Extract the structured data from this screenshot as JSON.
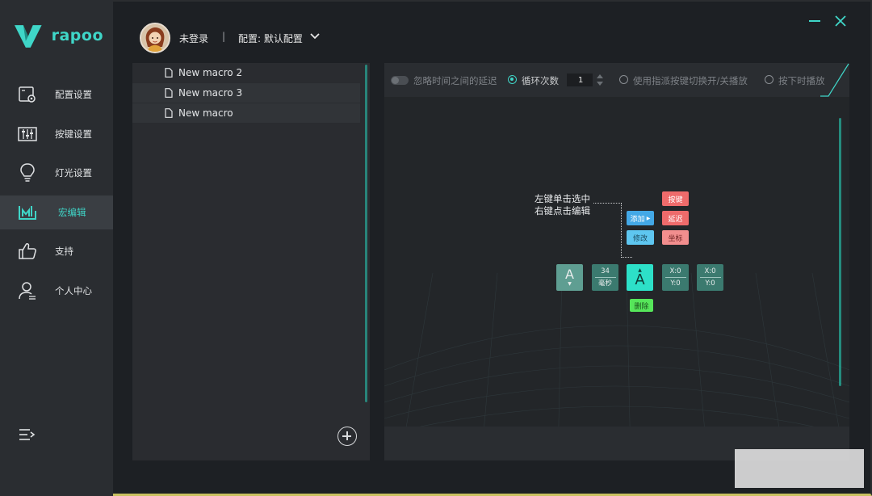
{
  "app": {
    "brand": "rapoo"
  },
  "sidebar": {
    "items": [
      {
        "label": "配置设置",
        "icon": "settings-card-icon"
      },
      {
        "label": "按键设置",
        "icon": "sliders-icon"
      },
      {
        "label": "灯光设置",
        "icon": "lightbulb-icon"
      },
      {
        "label": "宏编辑",
        "icon": "macro-icon"
      },
      {
        "label": "支持",
        "icon": "thumbs-up-icon"
      },
      {
        "label": "个人中心",
        "icon": "user-icon"
      }
    ],
    "active_index": 3
  },
  "header": {
    "user_status": "未登录",
    "separator": "|",
    "config_label": "配置: 默认配置"
  },
  "macros": {
    "items": [
      "New macro 2",
      "New macro 3",
      "New macro"
    ]
  },
  "toolbar": {
    "ignore_delay": "忽略时间之间的延迟",
    "loop_times": "循环次数",
    "loop_count": "1",
    "toggle_mode": "使用指派按键切换开/关播放",
    "hold_mode": "按下时播放"
  },
  "demo": {
    "hint_line1": "左键单击选中",
    "hint_line2": "右键点击编辑",
    "add": "添加",
    "edit": "修改",
    "key": "按键",
    "delay": "延迟",
    "coord": "坐标",
    "delete": "删除",
    "node_key": "A",
    "delay_value": "34",
    "delay_unit": "毫秒",
    "x_label": "X:0",
    "y_label": "Y:0"
  },
  "colors": {
    "accent": "#3fd6c8",
    "red_chip": "#ee6b6b",
    "blue_chip": "#43a8e6",
    "green_chip": "#56e65a"
  }
}
